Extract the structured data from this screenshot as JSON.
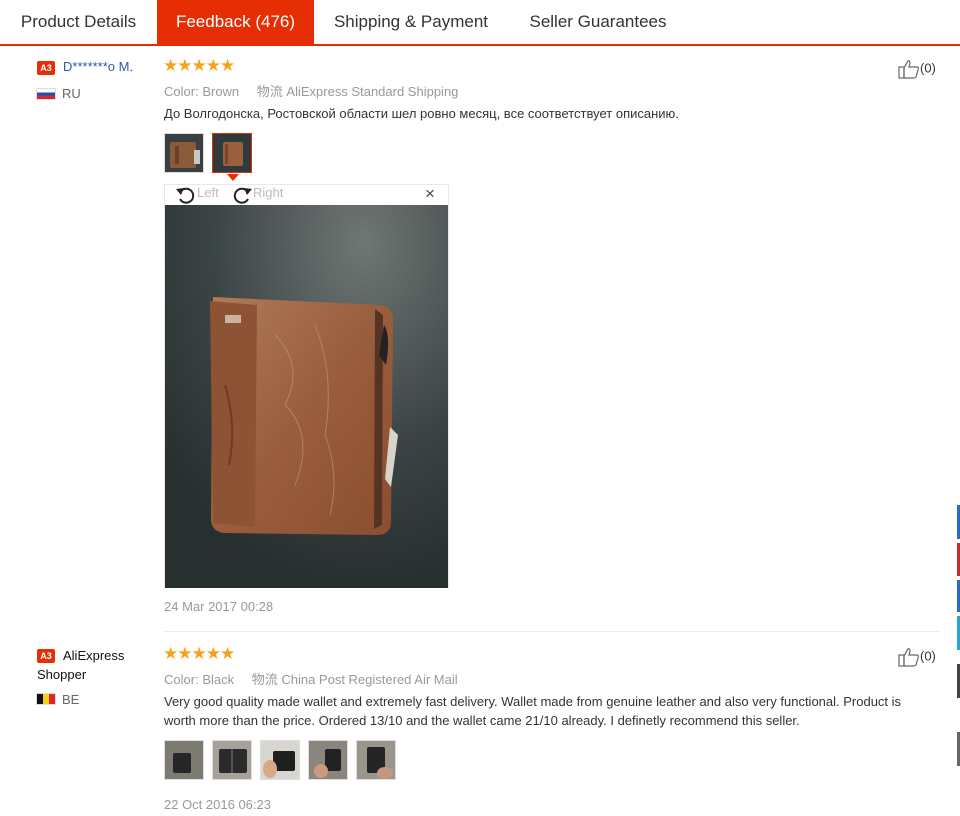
{
  "tabs": [
    {
      "label": "Product Details"
    },
    {
      "label": "Feedback (476)"
    },
    {
      "label": "Shipping & Payment"
    },
    {
      "label": "Seller Guarantees"
    }
  ],
  "feedbacks": [
    {
      "badge": "A3",
      "name": "D*******o M.",
      "country": "RU",
      "stars": "★★★★★",
      "color_label": "Color:",
      "color_value": "Brown",
      "shipping": "物流 AliExpress Standard Shipping",
      "text": "До Волгодонска, Ростовской области шел ровно месяц, все соответствует описанию.",
      "useful": "(0)",
      "viewer": {
        "left": "Left",
        "right": "Right",
        "close": "×"
      },
      "date": "24 Mar 2017 00:28"
    },
    {
      "badge": "A3",
      "name": "AliExpress Shopper",
      "country": "BE",
      "stars": "★★★★★",
      "color_label": "Color:",
      "color_value": "Black",
      "shipping": "物流 China Post Registered Air Mail",
      "text": "Very good quality made wallet and extremely fast delivery. Wallet made from genuine leather and also very functional. Product is worth more than the price. Ordered 13/10 and the wallet came 21/10 already. I definetly recommend this seller.",
      "useful": "(0)",
      "date": "22 Oct 2016 06:23"
    }
  ],
  "colors": {
    "accent": "#e62e04",
    "star": "#f7a21b",
    "link": "#2a5aa8"
  }
}
